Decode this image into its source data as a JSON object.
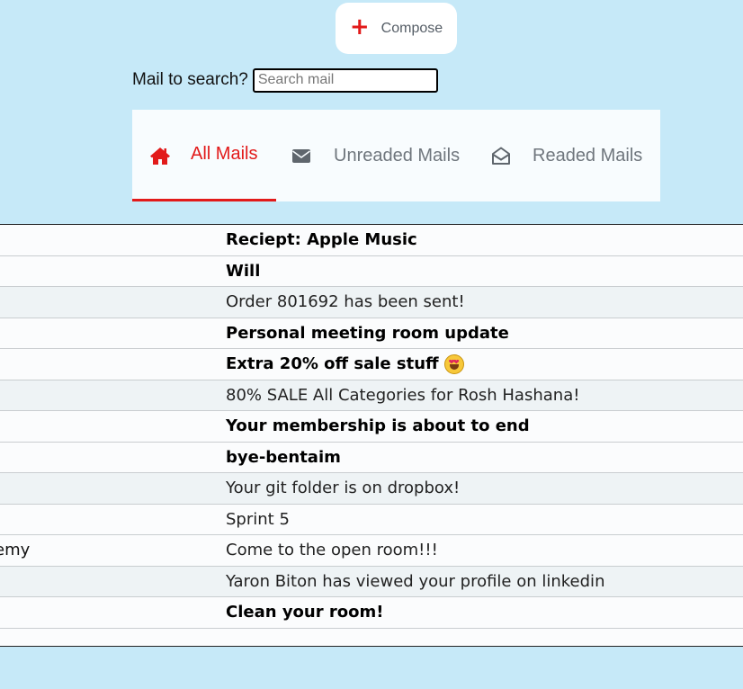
{
  "compose": {
    "icon": "plus-icon",
    "label": "Compose"
  },
  "search": {
    "label": "Mail to search?",
    "placeholder": "Search mail",
    "value": ""
  },
  "tabs": [
    {
      "label": "All Mails",
      "icon": "home-icon",
      "active": true
    },
    {
      "label": "Unreaded Mails",
      "icon": "envelope-closed-icon",
      "active": false
    },
    {
      "label": "Readed Mails",
      "icon": "envelope-open-icon",
      "active": false
    }
  ],
  "colors": {
    "accent": "#e21a1a",
    "background": "#c6e9f8",
    "tabs_bg": "#f8fcfe"
  },
  "mails": [
    {
      "from": "",
      "subject": "Reciept: Apple Music",
      "unread": true
    },
    {
      "from": "",
      "subject": "Will",
      "unread": true
    },
    {
      "from": "",
      "subject": "Order 801692 has been sent!",
      "unread": false
    },
    {
      "from": "",
      "subject": "Personal meeting room update",
      "unread": true
    },
    {
      "from": "",
      "subject": "Extra 20% off sale stuff",
      "unread": true,
      "emoji": "star-struck-emoji-icon"
    },
    {
      "from": "",
      "subject": "80% SALE All Categories for Rosh Hashana!",
      "unread": false
    },
    {
      "from": "",
      "subject": "Your membership is about to end",
      "unread": true
    },
    {
      "from": "",
      "subject": "bye-bentaim",
      "unread": true
    },
    {
      "from": "",
      "subject": "Your git folder is on dropbox!",
      "unread": false
    },
    {
      "from": "",
      "subject": "Sprint 5",
      "unread": false
    },
    {
      "from": "emy",
      "subject": "Come to the open room!!!",
      "unread": false
    },
    {
      "from": "",
      "subject": "Yaron Biton has viewed your profile on linkedin",
      "unread": false
    },
    {
      "from": "",
      "subject": "Clean your room!",
      "unread": true
    }
  ]
}
